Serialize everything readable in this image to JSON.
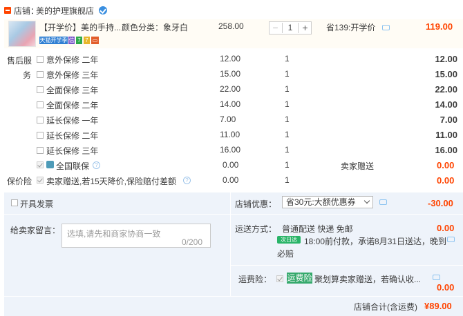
{
  "shop": {
    "label": "店铺：",
    "name": "美的护理旗舰店"
  },
  "item": {
    "title": "【开学价】美的手持...",
    "variant": "颜色分类：象牙白",
    "unit_price": "258.00",
    "quantity": "1",
    "minus": "−",
    "plus": "+",
    "promo": "省139:开学价",
    "total": "119.00",
    "badges": [
      "天猫开学季",
      "7",
      "7"
    ]
  },
  "service_group_label_1": "售后服",
  "service_group_label_2": "务",
  "services": [
    {
      "name": "意外保修 二年",
      "price": "12.00",
      "qty": "1",
      "total": "12.00"
    },
    {
      "name": "意外保修 三年",
      "price": "15.00",
      "qty": "1",
      "total": "15.00"
    },
    {
      "name": "全面保修 三年",
      "price": "22.00",
      "qty": "1",
      "total": "22.00"
    },
    {
      "name": "全面保修 二年",
      "price": "14.00",
      "qty": "1",
      "total": "14.00"
    },
    {
      "name": "延长保修 一年",
      "price": "7.00",
      "qty": "1",
      "total": "7.00"
    },
    {
      "name": "延长保修 二年",
      "price": "11.00",
      "qty": "1",
      "total": "11.00"
    },
    {
      "name": "延长保修 三年",
      "price": "16.00",
      "qty": "1",
      "total": "16.00"
    }
  ],
  "national_warranty": {
    "name": "全国联保",
    "price": "0.00",
    "qty": "1",
    "note": "卖家赠送",
    "total": "0.00"
  },
  "price_protection": {
    "group_label": "保价险",
    "name": "卖家赠送,若15天降价,保险赔付差额",
    "price": "0.00",
    "qty": "1",
    "total": "0.00"
  },
  "invoice_label": "开具发票",
  "shop_coupon": {
    "label": "店铺优惠：",
    "selected": "省30元:大额优惠券",
    "amount": "-30.00"
  },
  "remark": {
    "label": "给卖家留言：",
    "placeholder": "选填,请先和商家协商一致",
    "counter": "0/200"
  },
  "shipping": {
    "label": "运送方式：",
    "method": "普通配送 快递 免邮",
    "amount": "0.00",
    "tag": "次日达",
    "promise_line1": "18:00前付款，承诺8月31日送达，晚到",
    "promise_line2": "必赔"
  },
  "freight_insurance": {
    "label": "运费险：",
    "tag": "运费险",
    "text": "聚划算卖家赠送，若确认收...",
    "amount": "0.00"
  },
  "shop_total": {
    "label": "店铺合计(含运费)",
    "amount": "¥89.00"
  },
  "colors": {
    "accent": "#ff4400",
    "panel": "#eef3fa",
    "item_bg": "#fffcf5"
  }
}
